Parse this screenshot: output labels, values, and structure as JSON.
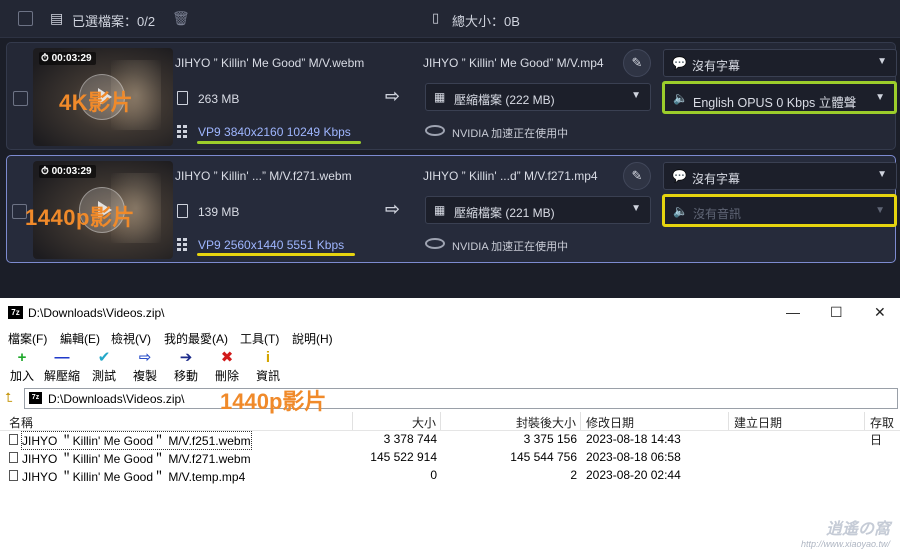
{
  "converter": {
    "topbar": {
      "selected_label": "已選檔案：0/2",
      "total_label": "總大小：0B"
    },
    "items": [
      {
        "duration": "00:03:29",
        "overlay_label": "4K影片",
        "source_name": "JIHYO ” Killin' Me Good”  M/V.webm",
        "source_size": "263 MB",
        "source_codec": "VP9 3840x2160 10249 Kbps",
        "codec_underline_color": "#9ccd2b",
        "output_name": "JIHYO ” Killin' Me Good”  M/V.mp4",
        "compress_label": "壓縮檔案 (222 MB)",
        "gpu_label": "NVIDIA 加速正在使用中",
        "subtitle_label": "沒有字幕",
        "audio_label": "English OPUS 0 Kbps 立體聲",
        "audio_highlight": "#9ccd2b"
      },
      {
        "duration": "00:03:29",
        "overlay_label": "1440p影片",
        "source_name": "JIHYO ” Killin' ...”  M/V.f271.webm",
        "source_size": "139 MB",
        "source_codec": "VP9 2560x1440 5551 Kbps",
        "codec_underline_color": "#e6d40f",
        "output_name": "JIHYO ” Killin' ...d”  M/V.f271.mp4",
        "compress_label": "壓縮檔案 (221 MB)",
        "gpu_label": "NVIDIA 加速正在使用中",
        "subtitle_label": "沒有字幕",
        "audio_label": "沒有音訊",
        "audio_highlight": "#e6d40f"
      }
    ]
  },
  "zip": {
    "title": "D:\\Downloads\\Videos.zip\\",
    "app_icon_text": "7z",
    "menu": [
      "檔案(F)",
      "編輯(E)",
      "檢視(V)",
      "我的最愛(A)",
      "工具(T)",
      "說明(H)"
    ],
    "toolbar": [
      {
        "label": "加入",
        "icon": "plus-icon",
        "glyph": "+",
        "color": "#1fa82b"
      },
      {
        "label": "解壓縮",
        "icon": "minus-icon",
        "glyph": "—",
        "color": "#1b35c9"
      },
      {
        "label": "測試",
        "icon": "check-icon",
        "glyph": "✔",
        "color": "#23a8c9"
      },
      {
        "label": "複製",
        "icon": "copy-arrow-icon",
        "glyph": "⇨",
        "color": "#2a4fc9"
      },
      {
        "label": "移動",
        "icon": "move-arrow-icon",
        "glyph": "➔",
        "color": "#1b2a8a"
      },
      {
        "label": "刪除",
        "icon": "delete-x-icon",
        "glyph": "✖",
        "color": "#d11a1a"
      },
      {
        "label": "資訊",
        "icon": "info-icon",
        "glyph": "i",
        "color": "#d3a500"
      }
    ],
    "address": "D:\\Downloads\\Videos.zip\\",
    "address_annotation": "1440p影片",
    "columns": [
      "名稱",
      "大小",
      "封裝後大小",
      "修改日期",
      "建立日期",
      "存取日"
    ],
    "files": [
      {
        "name": "JIHYO ＂Killin' Me Good＂ M/V.f251.webm",
        "size": "3 378 744",
        "packed": "3 375 156",
        "modified": "2023-08-18 14:43"
      },
      {
        "name": "JIHYO ＂Killin' Me Good＂ M/V.f271.webm",
        "size": "145 522 914",
        "packed": "145 544 756",
        "modified": "2023-08-18 06:58"
      },
      {
        "name": "JIHYO ＂Killin' Me Good＂ M/V.temp.mp4",
        "size": "0",
        "packed": "2",
        "modified": "2023-08-20 02:44"
      }
    ],
    "watermark_main": "逍遙の窩",
    "watermark_url": "http://www.xiaoyao.tw/"
  }
}
